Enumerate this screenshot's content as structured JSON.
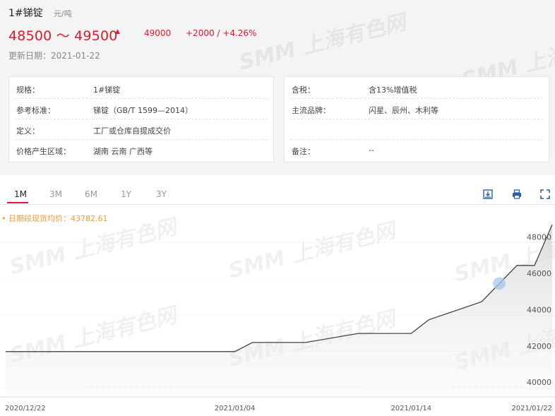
{
  "header": {
    "title": "1#锑锭",
    "unit": "元/吨",
    "price_range": "48500 ～ 49500",
    "previous_price": "49000",
    "change": "+2000  /  +4.26%",
    "update_date": "更新日期：2021-01-22"
  },
  "info_left": [
    {
      "label": "规格：",
      "value": "1#锑锭"
    },
    {
      "label": "参考标准：",
      "value": "锑锭（GB/T 1599—2014）"
    },
    {
      "label": "定义：",
      "value": "工厂或仓库自提成交价"
    },
    {
      "label": "价格产生区域：",
      "value": "湖南  云南  广西等"
    }
  ],
  "info_right": [
    {
      "label": "含税：",
      "value": "含13%增值税"
    },
    {
      "label": "主流品牌：",
      "value": "闪星、辰州、木利等"
    },
    {
      "label": "",
      "value": ""
    },
    {
      "label": "备注：",
      "value": "--"
    }
  ],
  "tabs": [
    "1M",
    "3M",
    "6M",
    "1Y",
    "3Y"
  ],
  "active_tab": "1M",
  "toolbar_icons": [
    "download-icon",
    "print-icon",
    "fullscreen-icon"
  ],
  "average_label": "• 日期段现货均价：43782.61",
  "watermark": "SMM 上海有色网",
  "colors": {
    "accent": "#e0182d",
    "line": "#444444",
    "average": "#f29a3a",
    "marker": "#a9c7ea"
  },
  "chart_data": {
    "type": "area",
    "x": [
      "2020-12-22",
      "2020-12-23",
      "2020-12-24",
      "2020-12-25",
      "2020-12-28",
      "2020-12-29",
      "2020-12-30",
      "2020-12-31",
      "2021-01-04",
      "2021-01-05",
      "2021-01-06",
      "2021-01-07",
      "2021-01-08",
      "2021-01-11",
      "2021-01-12",
      "2021-01-13",
      "2021-01-14",
      "2021-01-15",
      "2021-01-18",
      "2021-01-19",
      "2021-01-20",
      "2021-01-21",
      "2021-01-22"
    ],
    "series": [
      {
        "values": [
          42000,
          42000,
          42000,
          42000,
          42000,
          42000,
          42000,
          42000,
          42000,
          42500,
          42500,
          42500,
          42500,
          43000,
          43000,
          43000,
          43000,
          43750,
          44750,
          45750,
          46750,
          46750,
          49000
        ]
      }
    ],
    "x_tick_labels": [
      "2020/12/22",
      "2021/01/04",
      "2021/01/14",
      "2021/01/22"
    ],
    "x_tick_dates": [
      "2020-12-22",
      "2021-01-04",
      "2021-01-14",
      "2021-01-22"
    ],
    "y_ticks": [
      40000,
      42000,
      44000,
      46000,
      48000
    ],
    "ylim": [
      39500,
      49000
    ],
    "grid": true,
    "y_axis_side": "right",
    "highlighted_x": "2021-01-19"
  }
}
